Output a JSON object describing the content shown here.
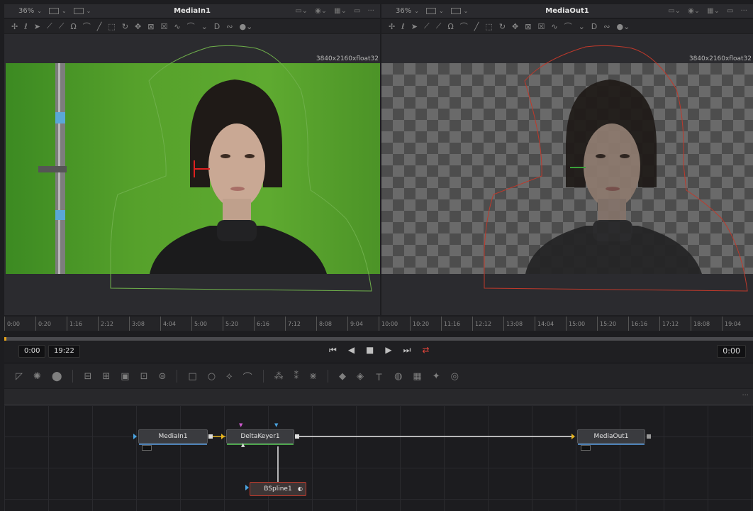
{
  "viewer_left": {
    "zoom": "36%",
    "title": "MediaIn1",
    "resolution": "3840x2160xfloat32"
  },
  "viewer_right": {
    "zoom": "36%",
    "title": "MediaOut1",
    "resolution": "3840x2160xfloat32"
  },
  "ruler_ticks": [
    "0:00",
    "0:20",
    "1:16",
    "2:12",
    "3:08",
    "4:04",
    "5:00",
    "5:20",
    "6:16",
    "7:12",
    "8:08",
    "9:04",
    "10:00",
    "10:20",
    "11:16",
    "12:12",
    "13:08",
    "14:04",
    "15:00",
    "15:20",
    "16:16",
    "17:12",
    "18:08",
    "19:04"
  ],
  "transport": {
    "start": "0:00",
    "end": "19:22",
    "current": "0:00"
  },
  "nodes": {
    "media_in": "MediaIn1",
    "delta_keyer": "DeltaKeyer1",
    "media_out": "MediaOut1",
    "bspline": "BSpline1"
  },
  "colors": {
    "green_screen": "#56a12b",
    "spline_green": "#6fb04b",
    "spline_red": "#c0392b",
    "accent": "#e8a41a",
    "link": "#4aa3e0"
  },
  "icons": {
    "viewer_tools": [
      "select-icon",
      "draw-icon",
      "arrow-icon",
      "polygon-icon",
      "bspline-icon",
      "bitmap-icon",
      "curve-icon",
      "line-icon",
      "rect-icon",
      "rotate-icon",
      "transform-icon",
      "wireframe-icon",
      "mask-icon",
      "spline-icon",
      "more-icon"
    ],
    "transport": [
      "skip-start-icon",
      "play-reverse-icon",
      "stop-icon",
      "play-icon",
      "skip-end-icon",
      "loop-icon"
    ]
  }
}
